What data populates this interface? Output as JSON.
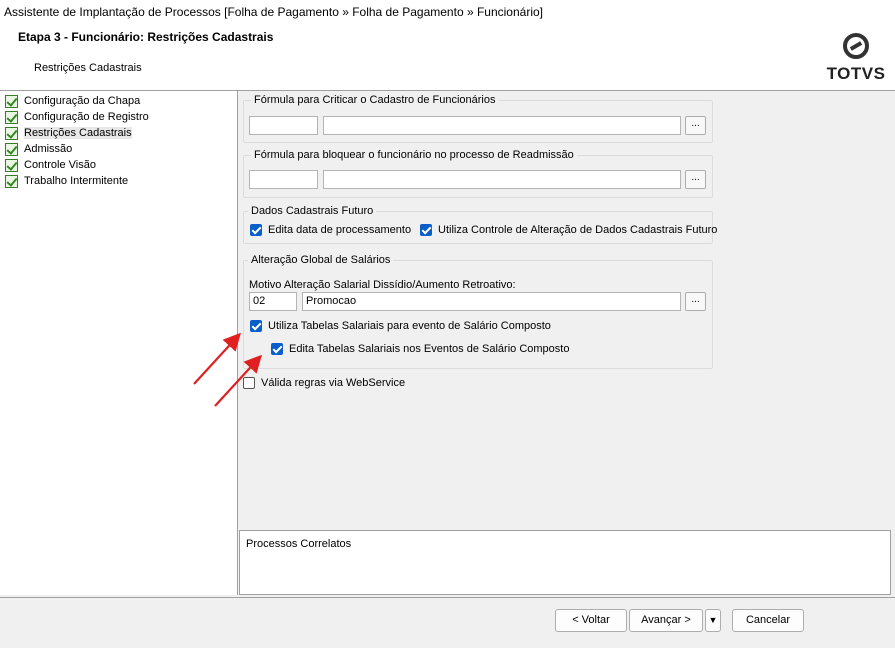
{
  "window": {
    "title": "Assistente de Implantação de Processos [Folha de Pagamento » Folha de Pagamento » Funcionário]"
  },
  "header": {
    "step_title": "Etapa 3 - Funcionário: Restrições Cadastrais",
    "step_subtitle": "Restrições Cadastrais",
    "logo_text": "TOTVS"
  },
  "steps": [
    {
      "label": "Configuração da Chapa",
      "done": true
    },
    {
      "label": "Configuração de Registro",
      "done": true
    },
    {
      "label": "Restrições Cadastrais",
      "done": true,
      "selected": true
    },
    {
      "label": "Admissão",
      "done": true
    },
    {
      "label": "Controle Visão",
      "done": true
    },
    {
      "label": "Trabalho Intermitente",
      "done": true
    }
  ],
  "formula_critica": {
    "title": "Fórmula para Criticar o Cadastro de Funcionários",
    "code": "",
    "description": "",
    "browse_label": "..."
  },
  "formula_bloqueio": {
    "title": "Fórmula para bloquear o funcionário no processo de Readmissão",
    "code": "",
    "description": "",
    "browse_label": "..."
  },
  "dados_futuro": {
    "title": "Dados Cadastrais Futuro",
    "edita_data_label": "Edita data de processamento",
    "edita_data_checked": true,
    "utiliza_controle_label": "Utiliza Controle de Alteração de Dados Cadastrais Futuro",
    "utiliza_controle_checked": true
  },
  "alteracao_global": {
    "title": "Alteração Global de Salários",
    "motivo_label": "Motivo Alteração Salarial Dissídio/Aumento Retroativo:",
    "motivo_code": "02",
    "motivo_description": "Promocao",
    "browse_label": "...",
    "utiliza_tabelas_label": "Utiliza Tabelas Salariais para evento de Salário Composto",
    "utiliza_tabelas_checked": true,
    "edita_tabelas_label": "Edita Tabelas Salariais nos Eventos de Salário Composto",
    "edita_tabelas_checked": true
  },
  "valida_webservice": {
    "label": "Válida regras via WebService",
    "checked": false
  },
  "related": {
    "title": "Processos Correlatos"
  },
  "footer": {
    "back_label": "< Voltar",
    "next_label": "Avançar >",
    "dropdown_label": "▼",
    "cancel_label": "Cancelar"
  },
  "colors": {
    "checkbox_accent": "#0a5ecc",
    "annotation_arrow": "#e02020"
  }
}
